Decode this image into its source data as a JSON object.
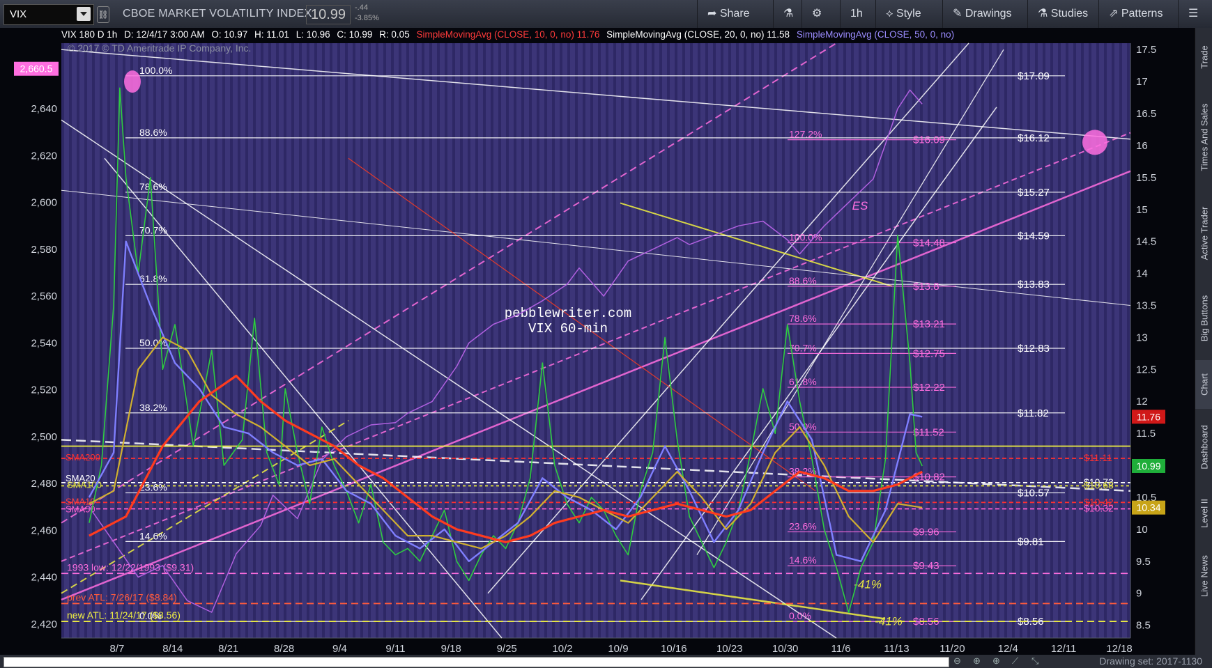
{
  "header": {
    "symbol": "VIX",
    "title": "CBOE MARKET VOLATILITY INDEX",
    "price": "10.99",
    "change": "-.44",
    "change_pct": "-3.85%",
    "buttons": [
      {
        "label": "Share",
        "icon": "share-icon"
      },
      {
        "label": "",
        "icon": "flask-icon"
      },
      {
        "label": "",
        "icon": "gear-icon"
      },
      {
        "label": "1h",
        "icon": ""
      },
      {
        "label": "Style",
        "icon": "style-icon"
      },
      {
        "label": "Drawings",
        "icon": "pencil-icon"
      },
      {
        "label": "Studies",
        "icon": "flask-icon"
      },
      {
        "label": "Patterns",
        "icon": "patterns-icon"
      },
      {
        "label": "",
        "icon": "menu-icon"
      }
    ]
  },
  "infobar": {
    "symbol_period": "VIX 180 D 1h",
    "date": "D: 12/4/17 3:00 AM",
    "open": "O: 10.97",
    "high": "H: 11.01",
    "low": "L: 10.96",
    "close": "C: 10.99",
    "range": "R: 0.05",
    "sma10_label": "SimpleMovingAvg (CLOSE, 10, 0, no)",
    "sma10_value": "11.76",
    "sma20_label": "SimpleMovingAvg (CLOSE, 20, 0, no)",
    "sma20_value": "11.58",
    "sma50_label": "SimpleMovingAvg (CLOSE, 50, 0, no)"
  },
  "copyright": "© 2017 © TD Ameritrade IP Company, Inc.",
  "sidebar_tabs": [
    "Trade",
    "Times And Sales",
    "Active Trader",
    "Big Buttons",
    "Chart",
    "Dashboard",
    "Level II",
    "Live News"
  ],
  "footer": {
    "drawing_set": "Drawing set: 2017-1130"
  },
  "chart_data": {
    "type": "line",
    "xlabel": "",
    "ylabel": "",
    "x_ticks": [
      "8/7",
      "8/14",
      "8/21",
      "8/28",
      "9/4",
      "9/11",
      "9/18",
      "9/25",
      "10/2",
      "10/9",
      "10/16",
      "10/23",
      "10/30",
      "11/6",
      "11/13",
      "11/20",
      "12/4",
      "12/11",
      "12/18"
    ],
    "right_axis": {
      "ticks": [
        8.5,
        9,
        9.5,
        10,
        10.5,
        11,
        11.5,
        12,
        12.5,
        13,
        13.5,
        14,
        14.5,
        15,
        15.5,
        16,
        16.5,
        17,
        17.5
      ],
      "ylim": [
        8.3,
        17.6
      ]
    },
    "left_axis": {
      "ticks": [
        2420,
        2440,
        2460,
        2480,
        2500,
        2520,
        2540,
        2560,
        2580,
        2600,
        2620,
        2640
      ],
      "ylim": [
        2414,
        2668
      ]
    },
    "left_badge": "2,660.5",
    "right_badges": [
      {
        "label": "11.76",
        "value": 11.76,
        "color": "#d01818"
      },
      {
        "label": "10.99",
        "value": 10.99,
        "color": "#1fae3a"
      },
      {
        "label": "10.34",
        "value": 10.34,
        "color": "#c8a418"
      }
    ],
    "series": [
      {
        "name": "VIX",
        "color": "#2ecc40",
        "values": [
          [
            0,
            10.1
          ],
          [
            2,
            11.0
          ],
          [
            4,
            13.5
          ],
          [
            5,
            16.9
          ],
          [
            6,
            15.5
          ],
          [
            8,
            14.0
          ],
          [
            10,
            15.5
          ],
          [
            12,
            12.5
          ],
          [
            14,
            13.2
          ],
          [
            17,
            11.3
          ],
          [
            20,
            12.8
          ],
          [
            22,
            11.0
          ],
          [
            25,
            11.4
          ],
          [
            27,
            13.3
          ],
          [
            29,
            11.2
          ],
          [
            31,
            10.7
          ],
          [
            32,
            12.2
          ],
          [
            34,
            11.2
          ],
          [
            36,
            10.4
          ],
          [
            38,
            11.6
          ],
          [
            40,
            11.0
          ],
          [
            42,
            10.6
          ],
          [
            44,
            10.1
          ],
          [
            46,
            10.7
          ],
          [
            48,
            9.8
          ],
          [
            50,
            9.6
          ],
          [
            52,
            9.7
          ],
          [
            54,
            9.5
          ],
          [
            56,
            9.9
          ],
          [
            58,
            10.3
          ],
          [
            60,
            9.5
          ],
          [
            62,
            9.2
          ],
          [
            64,
            9.6
          ],
          [
            66,
            9.9
          ],
          [
            68,
            9.7
          ],
          [
            70,
            10.1
          ],
          [
            72,
            10.8
          ],
          [
            74,
            12.6
          ],
          [
            76,
            11.0
          ],
          [
            78,
            10.4
          ],
          [
            80,
            10.1
          ],
          [
            82,
            10.5
          ],
          [
            84,
            10.3
          ],
          [
            86,
            9.9
          ],
          [
            88,
            9.6
          ],
          [
            90,
            10.6
          ],
          [
            92,
            11.2
          ],
          [
            94,
            13.0
          ],
          [
            96,
            11.4
          ],
          [
            98,
            10.2
          ],
          [
            100,
            9.8
          ],
          [
            102,
            9.4
          ],
          [
            104,
            9.8
          ],
          [
            106,
            10.3
          ],
          [
            108,
            11.2
          ],
          [
            110,
            12.2
          ],
          [
            112,
            11.5
          ],
          [
            114,
            13.2
          ],
          [
            116,
            12.0
          ],
          [
            118,
            11.1
          ],
          [
            120,
            10.0
          ],
          [
            122,
            9.4
          ],
          [
            124,
            8.7
          ],
          [
            126,
            9.4
          ],
          [
            128,
            9.8
          ],
          [
            130,
            11.1
          ],
          [
            132,
            14.6
          ],
          [
            134,
            12.6
          ],
          [
            135,
            11.2
          ],
          [
            136,
            10.99
          ]
        ]
      },
      {
        "name": "SimpleMovingAvg (CLOSE, 10, 0, no)",
        "color": "#7f7fff",
        "values": [
          [
            0,
            10.5
          ],
          [
            4,
            11.2
          ],
          [
            6,
            14.5
          ],
          [
            10,
            13.5
          ],
          [
            14,
            12.6
          ],
          [
            18,
            12.2
          ],
          [
            22,
            11.6
          ],
          [
            26,
            11.5
          ],
          [
            30,
            11.2
          ],
          [
            34,
            11.0
          ],
          [
            38,
            11.1
          ],
          [
            42,
            10.6
          ],
          [
            46,
            10.4
          ],
          [
            50,
            9.9
          ],
          [
            54,
            9.7
          ],
          [
            58,
            10.0
          ],
          [
            62,
            9.5
          ],
          [
            66,
            9.8
          ],
          [
            70,
            10.1
          ],
          [
            74,
            10.8
          ],
          [
            78,
            10.5
          ],
          [
            82,
            10.3
          ],
          [
            86,
            10.0
          ],
          [
            90,
            10.5
          ],
          [
            94,
            11.3
          ],
          [
            98,
            10.6
          ],
          [
            102,
            9.8
          ],
          [
            106,
            10.3
          ],
          [
            110,
            11.2
          ],
          [
            114,
            12.0
          ],
          [
            118,
            11.4
          ],
          [
            122,
            9.6
          ],
          [
            126,
            9.5
          ],
          [
            130,
            10.3
          ],
          [
            134,
            11.8
          ],
          [
            136,
            11.76
          ]
        ]
      },
      {
        "name": "SimpleMovingAvg (CLOSE, 20, 0, no)",
        "color": "#d0b030",
        "values": [
          [
            0,
            10.4
          ],
          [
            4,
            10.6
          ],
          [
            8,
            12.5
          ],
          [
            12,
            13.0
          ],
          [
            16,
            12.8
          ],
          [
            20,
            12.1
          ],
          [
            24,
            11.8
          ],
          [
            28,
            11.6
          ],
          [
            32,
            11.3
          ],
          [
            36,
            11.0
          ],
          [
            40,
            11.1
          ],
          [
            44,
            10.7
          ],
          [
            48,
            10.3
          ],
          [
            52,
            9.9
          ],
          [
            56,
            9.9
          ],
          [
            60,
            9.8
          ],
          [
            64,
            9.7
          ],
          [
            68,
            9.9
          ],
          [
            72,
            10.2
          ],
          [
            76,
            10.6
          ],
          [
            80,
            10.5
          ],
          [
            84,
            10.3
          ],
          [
            88,
            10.1
          ],
          [
            92,
            10.5
          ],
          [
            96,
            10.9
          ],
          [
            100,
            10.5
          ],
          [
            104,
            10.0
          ],
          [
            108,
            10.4
          ],
          [
            112,
            11.2
          ],
          [
            116,
            11.6
          ],
          [
            120,
            11.0
          ],
          [
            124,
            10.2
          ],
          [
            128,
            9.8
          ],
          [
            132,
            10.4
          ],
          [
            136,
            10.34
          ]
        ]
      },
      {
        "name": "SimpleMovingAvg (CLOSE, 50, 0, no)",
        "color": "#ff3b1f",
        "values": [
          [
            0,
            9.9
          ],
          [
            6,
            10.2
          ],
          [
            12,
            11.3
          ],
          [
            18,
            12.0
          ],
          [
            24,
            12.4
          ],
          [
            28,
            12.0
          ],
          [
            32,
            11.7
          ],
          [
            36,
            11.5
          ],
          [
            40,
            11.3
          ],
          [
            44,
            11.0
          ],
          [
            48,
            10.8
          ],
          [
            52,
            10.5
          ],
          [
            56,
            10.2
          ],
          [
            60,
            10.0
          ],
          [
            64,
            9.9
          ],
          [
            68,
            9.8
          ],
          [
            72,
            9.9
          ],
          [
            76,
            10.1
          ],
          [
            80,
            10.2
          ],
          [
            84,
            10.3
          ],
          [
            88,
            10.2
          ],
          [
            92,
            10.3
          ],
          [
            96,
            10.4
          ],
          [
            100,
            10.3
          ],
          [
            104,
            10.2
          ],
          [
            108,
            10.3
          ],
          [
            112,
            10.6
          ],
          [
            116,
            10.9
          ],
          [
            120,
            10.8
          ],
          [
            124,
            10.6
          ],
          [
            128,
            10.6
          ],
          [
            132,
            10.7
          ],
          [
            136,
            10.9
          ]
        ]
      },
      {
        "name": "SPX",
        "color": "#b060e0",
        "values": [
          [
            0,
            2470
          ],
          [
            4,
            2455
          ],
          [
            8,
            2440
          ],
          [
            12,
            2445
          ],
          [
            16,
            2430
          ],
          [
            20,
            2425
          ],
          [
            24,
            2450
          ],
          [
            28,
            2462
          ],
          [
            30,
            2475
          ],
          [
            34,
            2465
          ],
          [
            38,
            2490
          ],
          [
            42,
            2500
          ],
          [
            46,
            2505
          ],
          [
            50,
            2506
          ],
          [
            52,
            2510
          ],
          [
            56,
            2515
          ],
          [
            60,
            2530
          ],
          [
            62,
            2540
          ],
          [
            66,
            2548
          ],
          [
            70,
            2552
          ],
          [
            74,
            2558
          ],
          [
            78,
            2565
          ],
          [
            80,
            2572
          ],
          [
            84,
            2560
          ],
          [
            88,
            2575
          ],
          [
            92,
            2580
          ],
          [
            96,
            2585
          ],
          [
            98,
            2582
          ],
          [
            102,
            2586
          ],
          [
            106,
            2590
          ],
          [
            110,
            2592
          ],
          [
            114,
            2584
          ],
          [
            116,
            2578
          ],
          [
            120,
            2590
          ],
          [
            124,
            2600
          ],
          [
            128,
            2610
          ],
          [
            130,
            2625
          ],
          [
            132,
            2640
          ],
          [
            134,
            2648
          ],
          [
            136,
            2642
          ]
        ]
      }
    ],
    "fib_left": {
      "labels": [
        "100.0%",
        "88.6%",
        "78.6%",
        "70.7%",
        "61.8%",
        "50.0%",
        "38.2%",
        "23.6%",
        "14.6%",
        "0.0%"
      ],
      "values": [
        17.09,
        16.12,
        15.27,
        14.59,
        13.83,
        12.83,
        11.82,
        10.57,
        9.81,
        8.56
      ]
    },
    "fib_right_values": [
      "$17.09",
      "$16.12",
      "$15.27",
      "$14.59",
      "$13.83",
      "$12.83",
      "$11.82",
      "$10.57",
      "$9.81",
      "$8.56"
    ],
    "fib_mid": {
      "labels": [
        "127.2%",
        "100.0%",
        "88.6%",
        "78.6%",
        "70.7%",
        "61.8%",
        "50.0%",
        "38.2%",
        "23.6%",
        "14.6%",
        "0.0%"
      ],
      "values_text": [
        "$16.09",
        "$14.48",
        "$13.8",
        "$13.21",
        "$12.75",
        "$12.22",
        "$11.52",
        "$10.82",
        "$9.96",
        "$9.43",
        "$8.56"
      ],
      "values": [
        16.09,
        14.48,
        13.8,
        13.21,
        12.75,
        12.22,
        11.52,
        10.82,
        9.96,
        9.43,
        8.56
      ]
    },
    "annotations": [
      {
        "text": "pebblewriter.com",
        "color": "#ffffff"
      },
      {
        "text": "VIX 60-min",
        "color": "#ffffff"
      },
      {
        "text": "1993 low: 12/22/1993 ($9.31)",
        "color": "#ff6ee0",
        "value": 9.31
      },
      {
        "text": "prev ATL: 7/26/17 ($8.84)",
        "color": "#ff5a3c",
        "value": 8.84
      },
      {
        "text": "new ATL: 11/24/17 ($8.56)",
        "color": "#f0f040",
        "value": 8.56
      },
      {
        "text": "SMA200",
        "color": "#ff3030",
        "value": 11.11
      },
      {
        "text": "SMA20",
        "color": "#ffffff",
        "value": 10.73
      },
      {
        "text": "SMA100",
        "color": "#e0e040",
        "value": 10.68
      },
      {
        "text": "SMA10",
        "color": "#ff4040",
        "value": 10.42
      },
      {
        "text": "SMA50",
        "color": "#ff60d0",
        "value": 10.32
      },
      {
        "text": "-41%",
        "color": "#e8e840"
      },
      {
        "text": "-41%",
        "color": "#e8e840"
      },
      {
        "text": "ES",
        "color": "#ff6ee0"
      }
    ],
    "level_labels": [
      {
        "text": "$11.11",
        "value": 11.11,
        "color": "#ff3030"
      },
      {
        "text": "$10.73",
        "value": 10.73,
        "color": "#ffffff"
      },
      {
        "text": "$10.68",
        "value": 10.68,
        "color": "#e0e040"
      },
      {
        "text": "$10.42",
        "value": 10.42,
        "color": "#ff3030"
      },
      {
        "text": "$10.32",
        "value": 10.32,
        "color": "#ff60d0"
      }
    ]
  }
}
